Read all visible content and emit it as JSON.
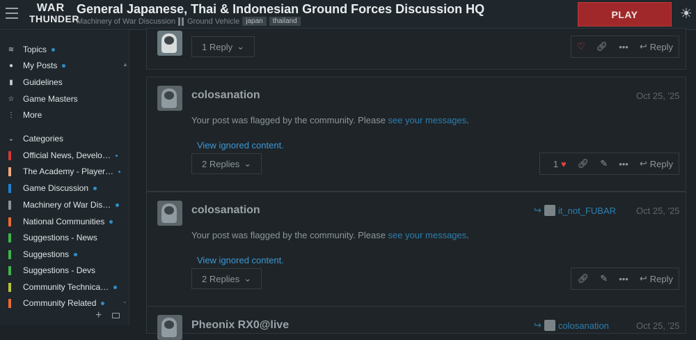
{
  "header": {
    "logo_line1": "WAR",
    "logo_line2": "THUNDER",
    "title": "General Japanese, Thai & Indonesian Ground Forces Discussion HQ",
    "category": "Machinery of War Discussion",
    "subcategory": "Ground Vehicle",
    "tags": [
      "japan",
      "thailand"
    ],
    "play_label": "PLAY"
  },
  "sidebar": {
    "items": [
      {
        "label": "Topics",
        "icon": "layers-icon"
      },
      {
        "label": "My Posts",
        "icon": "user-icon"
      },
      {
        "label": "Guidelines",
        "icon": "book-icon"
      },
      {
        "label": "Game Masters",
        "icon": "star-icon"
      },
      {
        "label": "More",
        "icon": "ellipsis-icon"
      }
    ],
    "categories_label": "Categories",
    "categories": [
      {
        "label": "Official News, Develo…",
        "color": "#d33a3a"
      },
      {
        "label": "The Academy - Player…",
        "color": "#f3a87c"
      },
      {
        "label": "Game Discussion",
        "color": "#1e7fd1"
      },
      {
        "label": "Machinery of War Dis…",
        "color": "#8e9396"
      },
      {
        "label": "National Communities",
        "color": "#ea6a32"
      },
      {
        "label": "Suggestions - News",
        "color": "#3fb44a"
      },
      {
        "label": "Suggestions",
        "color": "#3fb44a"
      },
      {
        "label": "Suggestions - Devs",
        "color": "#3fb44a"
      },
      {
        "label": "Community Technica…",
        "color": "#b5c43a"
      },
      {
        "label": "Community Related",
        "color": "#ea6a32"
      }
    ]
  },
  "posts": [
    {
      "replies": "1 Reply",
      "reply_label": "Reply"
    },
    {
      "username": "colosanation",
      "date": "Oct 25, '25",
      "text": "Your post was flagged by the community. Please ",
      "link": "see your messages",
      "text_end": ".",
      "ignored": "View ignored content.",
      "replies": "2 Replies",
      "likes": "1",
      "reply_label": "Reply"
    },
    {
      "username": "colosanation",
      "reply_to": "it_not_FUBAR",
      "date": "Oct 25, '25",
      "text": "Your post was flagged by the community. Please ",
      "link": "see your messages",
      "text_end": ".",
      "ignored": "View ignored content.",
      "replies": "2 Replies",
      "reply_label": "Reply"
    },
    {
      "username": "Pheonix RX0@live",
      "reply_to": "colosanation",
      "date": "Oct 25, '25"
    }
  ]
}
